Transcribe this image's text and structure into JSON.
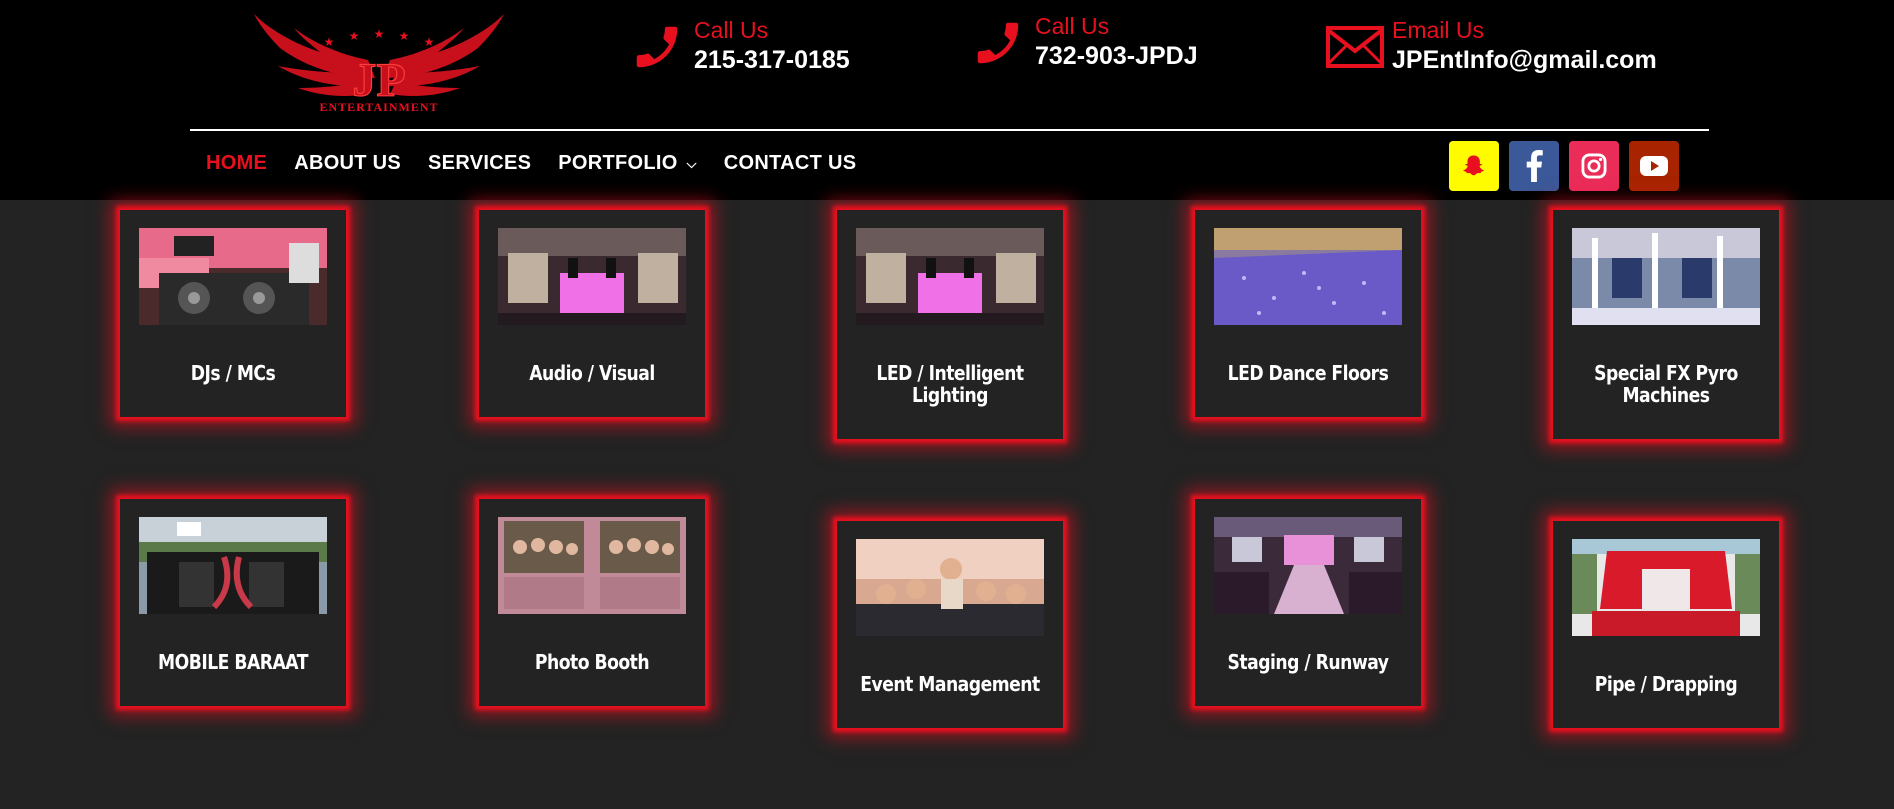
{
  "logo": {
    "letters": "JP",
    "tagline": "ENTERTAINMENT"
  },
  "contacts": [
    {
      "label": "Call Us",
      "value": "215-317-0185",
      "icon": "phone-icon"
    },
    {
      "label": "Call Us",
      "value": "732-903-JPDJ",
      "icon": "phone-icon"
    },
    {
      "label": "Email Us",
      "value": "JPEntInfo@gmail.com",
      "icon": "envelope-icon"
    }
  ],
  "nav": {
    "items": [
      {
        "label": "HOME",
        "active": true
      },
      {
        "label": "ABOUT US"
      },
      {
        "label": "SERVICES"
      },
      {
        "label": "PORTFOLIO"
      },
      {
        "label": "CONTACT US"
      }
    ]
  },
  "social": [
    {
      "name": "snapchat",
      "color": "#fffc00"
    },
    {
      "name": "facebook",
      "color": "#3b5998"
    },
    {
      "name": "instagram",
      "color": "#ea2c59"
    },
    {
      "name": "youtube",
      "color": "#a82400"
    }
  ],
  "services": [
    {
      "title": "DJs / MCs"
    },
    {
      "title": "Audio / Visual"
    },
    {
      "title": "LED / Intelligent Lighting"
    },
    {
      "title": "LED Dance Floors"
    },
    {
      "title": "Special FX Pyro Machines"
    },
    {
      "title": "MOBILE BARAAT"
    },
    {
      "title": "Photo Booth"
    },
    {
      "title": "Event Management"
    },
    {
      "title": "Staging / Runway"
    },
    {
      "title": "Pipe / Drapping"
    }
  ],
  "colors": {
    "accent": "#e8101f",
    "header_bg": "#000000",
    "page_bg": "#232323"
  }
}
